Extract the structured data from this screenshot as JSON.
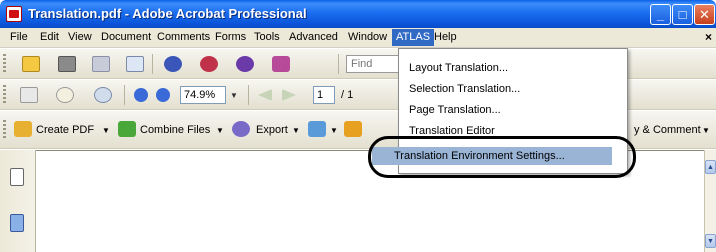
{
  "window": {
    "title": "Translation.pdf - Adobe Acrobat Professional",
    "minimize_glyph": "_",
    "maximize_glyph": "□",
    "close_glyph": "✕"
  },
  "menubar": {
    "items": [
      "File",
      "Edit",
      "View",
      "Document",
      "Comments",
      "Forms",
      "Tools",
      "Advanced",
      "Window",
      "ATLAS",
      "Help"
    ],
    "active": "ATLAS",
    "close_glyph": "×"
  },
  "toolbar1": {
    "find_placeholder": "Find",
    "icons": [
      "open-icon",
      "print-icon",
      "save-icon",
      "email-icon",
      "atlas-tool-icon-1",
      "atlas-tool-icon-2",
      "atlas-tool-icon-3",
      "atlas-tool-icon-4"
    ]
  },
  "toolbar2": {
    "zoom_value": "74.9%",
    "page_current": "1",
    "page_total": "/ 1"
  },
  "toolbar3": {
    "create_pdf": "Create PDF",
    "combine_files": "Combine Files",
    "export": "Export",
    "review_comment": "y & Comment"
  },
  "atlas_menu": {
    "items": [
      "Layout Translation...",
      "Selection Translation...",
      "Page Translation...",
      "Translation Editor"
    ],
    "highlighted": "Translation Environment Settings..."
  },
  "scrollbar": {
    "up_glyph": "▲",
    "down_glyph": "▼"
  },
  "colors": {
    "titlebar": "#1b6ef0",
    "menu_highlight": "#316ac5",
    "item_highlight": "#9ab4d6"
  }
}
